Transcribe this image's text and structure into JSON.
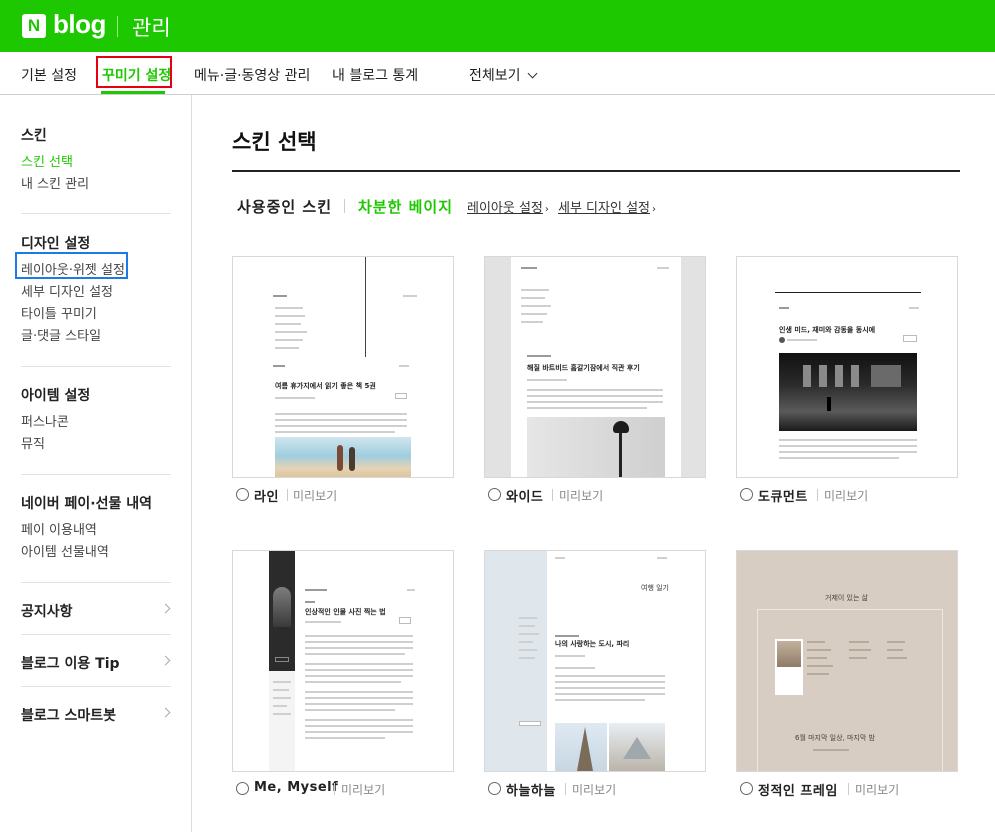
{
  "header": {
    "logo_mark": "N",
    "logo_text": "blog",
    "admin_label": "관리"
  },
  "topnav": {
    "items": [
      {
        "label": "기본 설정"
      },
      {
        "label": "꾸미기 설정"
      },
      {
        "label": "메뉴·글·동영상 관리"
      },
      {
        "label": "내 블로그 통계"
      },
      {
        "label": "전체보기"
      }
    ]
  },
  "sidebar": {
    "sections": [
      {
        "title": "스킨",
        "items": [
          "스킨 선택",
          "내 스킨 관리"
        ]
      },
      {
        "title": "디자인 설정",
        "items": [
          "레이아웃·위젯 설정",
          "세부 디자인 설정",
          "타이틀 꾸미기",
          "글·댓글 스타일"
        ]
      },
      {
        "title": "아이템 설정",
        "items": [
          "퍼스나콘",
          "뮤직"
        ]
      },
      {
        "title": "네이버 페이·선물 내역",
        "items": [
          "페이 이용내역",
          "아이템 선물내역"
        ]
      }
    ],
    "links": [
      "공지사항",
      "블로그 이용 Tip",
      "블로그 스마트봇"
    ]
  },
  "main": {
    "title": "스킨 선택",
    "current_label": "사용중인 스킨",
    "current_skin": "차분한 베이지",
    "layout_link": "레이아웃 설정",
    "detail_link": "세부 디자인 설정",
    "preview_label": "미리보기",
    "skins": [
      {
        "name": "라인",
        "thumb_title": "여름 휴가지에서 읽기 좋은 책 5권"
      },
      {
        "name": "와이드",
        "thumb_title": "해질 바트비드 홈갈기잠에서 직관 후기"
      },
      {
        "name": "도큐먼트",
        "thumb_title": "인생 미드, 재미와 감동을 동시에"
      },
      {
        "name": "Me, Myself",
        "thumb_title": "인상적인 인물 사진 찍는 법"
      },
      {
        "name": "하늘하늘",
        "thumb_title": "나의 사랑하는 도시, 파리"
      },
      {
        "name": "정적인 프레임",
        "thumb_title": "6월 마지막 일상, 마지막 밤"
      }
    ],
    "thumb_extras": {
      "sky_banner": "여행 일기",
      "frame_banner": "거제이 있는 삶"
    }
  },
  "colors": {
    "brand_green": "#1ec800",
    "highlight_red": "#e60012",
    "highlight_blue": "#1a7be8"
  }
}
